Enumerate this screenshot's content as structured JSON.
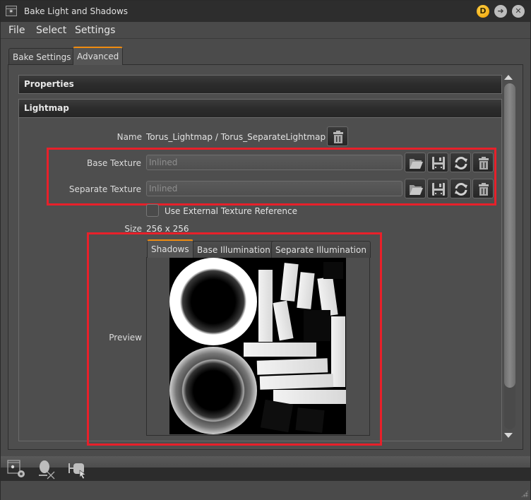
{
  "window": {
    "title": "Bake Light and Shadows",
    "title_buttons": {
      "badge_label": "D",
      "arrow_glyph": "➜",
      "close_glyph": "✕"
    }
  },
  "menubar": {
    "items": [
      {
        "label": "File"
      },
      {
        "label": "Select"
      },
      {
        "label": "Settings"
      }
    ]
  },
  "tabs": [
    {
      "label": "Bake Settings",
      "active": false
    },
    {
      "label": "Advanced",
      "active": true
    }
  ],
  "sections": {
    "properties": {
      "title": "Properties"
    },
    "lightmap": {
      "title": "Lightmap",
      "name_label": "Name",
      "name_value": "Torus_Lightmap / Torus_SeparateLightmap",
      "base_texture_label": "Base Texture",
      "base_texture_placeholder": "Inlined",
      "separate_texture_label": "Separate Texture",
      "separate_texture_placeholder": "Inlined",
      "use_external_label": "Use External Texture Reference",
      "use_external_checked": false,
      "size_label": "Size",
      "size_value": "256 x 256",
      "preview_label": "Preview",
      "preview_tabs": [
        {
          "label": "Shadows",
          "active": true
        },
        {
          "label": "Base Illumination",
          "active": false
        },
        {
          "label": "Separate Illumination",
          "active": false
        }
      ]
    }
  },
  "colors": {
    "accent": "#f08c10",
    "highlight_box": "#e8202a",
    "badge": "#f0a000"
  },
  "bottom_toolbar": {
    "icons": [
      "bake-settings-icon",
      "clear-light-icon",
      "select-light-icon"
    ]
  }
}
